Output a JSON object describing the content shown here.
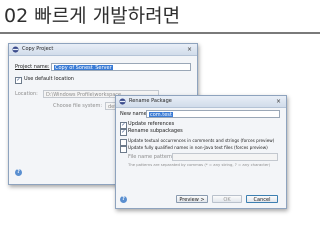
{
  "slide": {
    "title": "02 빠르게 개발하려면"
  },
  "copy_project": {
    "title": "Copy Project",
    "project_name_label": "Project name:",
    "project_name_value": "Copy of Sonest_Server",
    "use_default_label": "Use default location",
    "location_label": "Location:",
    "location_value": "D:\\Windows Profile\\workspace",
    "choose_fs_label": "Choose file system:",
    "choose_fs_value": "default",
    "close": "×",
    "help": "?"
  },
  "rename_package": {
    "title": "Rename Package",
    "new_name_label": "New name:",
    "new_name_value": "com.test",
    "options": [
      {
        "label": "Update references",
        "checked": true
      },
      {
        "label": "Rename subpackages",
        "checked": true
      },
      {
        "label": "Update textual occurrences in comments and strings (forces preview)",
        "checked": false
      },
      {
        "label": "Update fully qualified names in non-Java text files (forces preview)",
        "checked": false
      }
    ],
    "file_patterns_label": "File name patterns:",
    "patterns_hint": "The patterns are separated by commas (* = any string, ? = any character)",
    "buttons": {
      "preview": "Preview >",
      "ok": "OK",
      "cancel": "Cancel"
    },
    "close": "×",
    "help": "?"
  },
  "colors": {
    "selection": "#3a7bd5",
    "dialog_border": "#8ea3be",
    "title_rule": "#7a7a7a"
  }
}
